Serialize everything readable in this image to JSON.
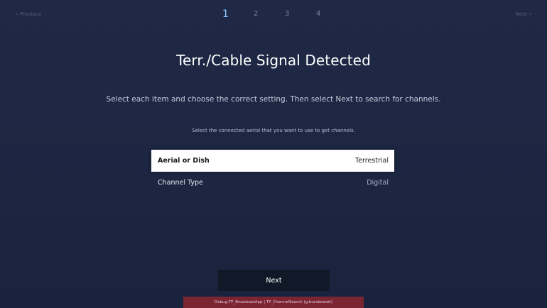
{
  "nav": {
    "previous_label": "Previous",
    "next_label": "Next",
    "previous_icon": "chevron-left-icon",
    "next_icon": "chevron-right-icon"
  },
  "steps": [
    {
      "label": "1",
      "active": true
    },
    {
      "label": "2",
      "active": false
    },
    {
      "label": "3",
      "active": false
    },
    {
      "label": "4",
      "active": false
    }
  ],
  "title": "Terr./Cable Signal Detected",
  "subtitle": "Select each item and choose the correct setting. Then select Next to search for channels.",
  "hint": "Select the connected aerial that you want to use to get channels.",
  "settings": [
    {
      "label": "Aerial or Dish",
      "value": "Terrestrial",
      "focused": true
    },
    {
      "label": "Channel Type",
      "value": "Digital",
      "focused": false
    }
  ],
  "next_button_label": "Next",
  "debug_text": "Debug:TP_BroadcastApp | TP_ChannelSearch (g.burakowski)",
  "colors": {
    "background": "#1d2743",
    "active_step": "#8fc8ff",
    "debug_bar": "#7b2432"
  }
}
